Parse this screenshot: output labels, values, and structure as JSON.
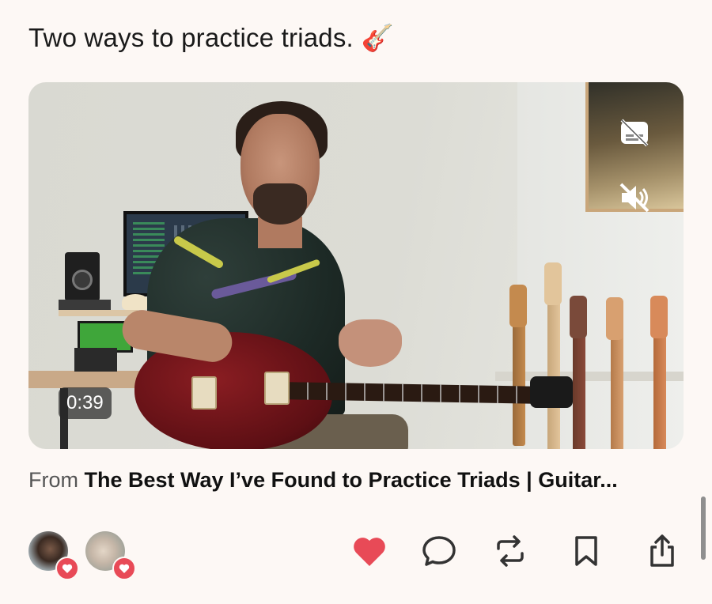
{
  "post": {
    "text": "Two ways to practice triads.",
    "emoji": "🎸"
  },
  "video": {
    "duration": "0:39",
    "captions_icon": "captions-off-icon",
    "mute_icon": "volume-muted-icon"
  },
  "source": {
    "prefix": "From",
    "title": "The Best Way I’ve Found to Practice Triads | Guitar..."
  },
  "reactions": {
    "avatars": [
      "avatar-user-1",
      "avatar-user-2"
    ],
    "badge_icon": "heart-icon",
    "badge_color": "#e84a57"
  },
  "actions": [
    {
      "name": "like",
      "icon": "heart-filled-icon",
      "active": true,
      "color": "#e84a57"
    },
    {
      "name": "reply",
      "icon": "comment-icon"
    },
    {
      "name": "repost",
      "icon": "repost-icon"
    },
    {
      "name": "bookmark",
      "icon": "bookmark-icon"
    },
    {
      "name": "share",
      "icon": "share-icon"
    }
  ]
}
